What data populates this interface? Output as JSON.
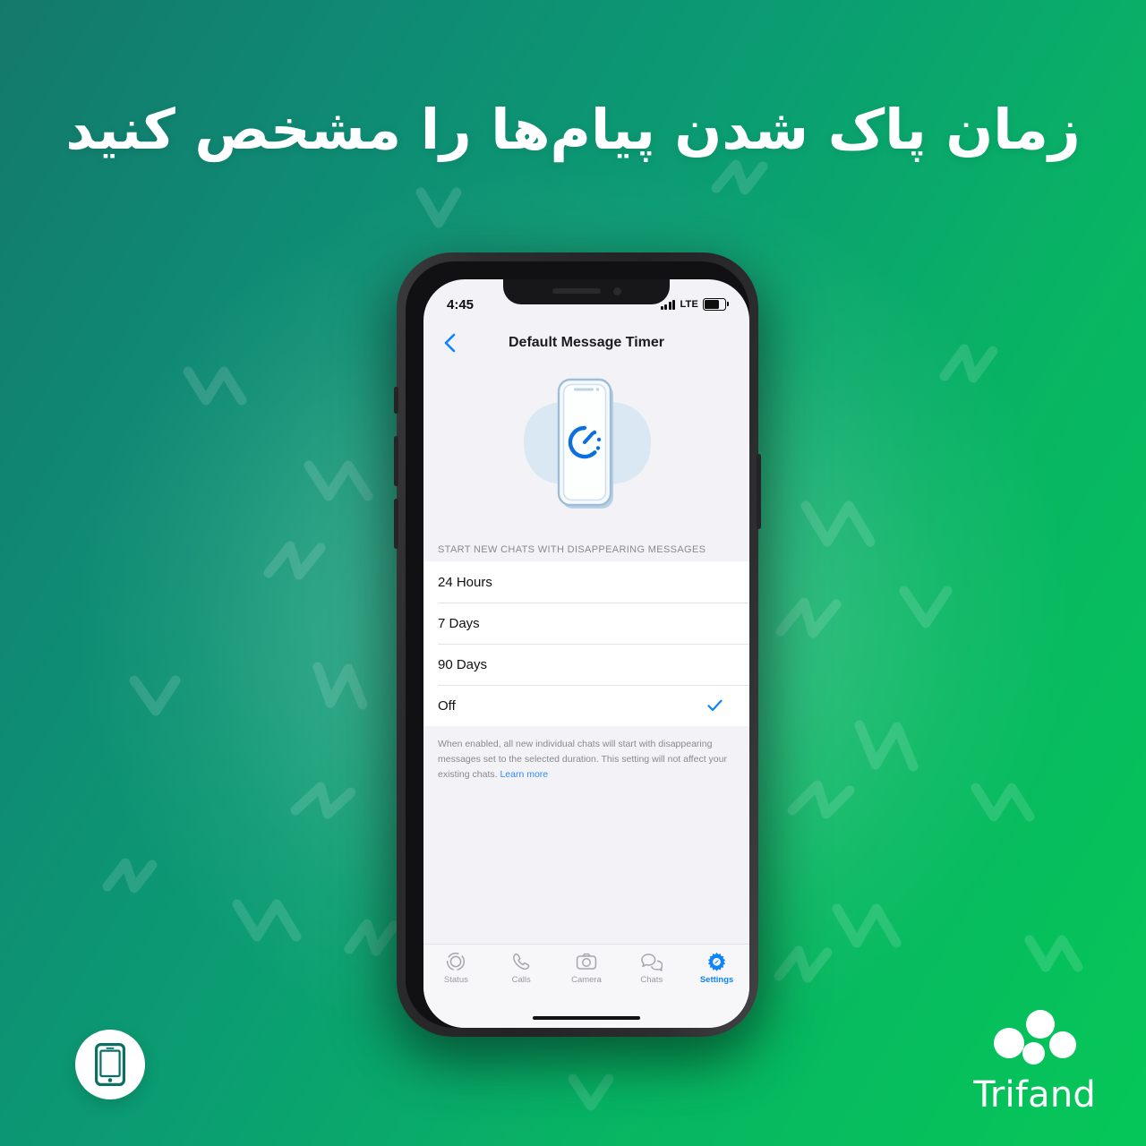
{
  "headline": "زمان پاک شدن پیام‌ها را مشخص کنید",
  "colors": {
    "gradient_start": "#14796b",
    "gradient_end": "#05c757",
    "accent_blue": "#0b84fe",
    "screen_bg": "#f2f2f7",
    "brand_white": "#ffffff"
  },
  "phone": {
    "status_bar": {
      "time": "4:45",
      "network": "LTE",
      "signal_icon": "signal-bars-icon",
      "battery_icon": "battery-icon"
    },
    "nav": {
      "back_icon": "chevron-left-icon",
      "title": "Default Message Timer"
    },
    "hero": {
      "illustration_icon": "phone-timer-illustration"
    },
    "section": {
      "header": "START NEW CHATS WITH DISAPPEARING MESSAGES",
      "options": [
        {
          "label": "24 Hours",
          "selected": false
        },
        {
          "label": "7 Days",
          "selected": false
        },
        {
          "label": "90 Days",
          "selected": false
        },
        {
          "label": "Off",
          "selected": true
        }
      ],
      "selected_icon": "checkmark-icon"
    },
    "footnote": {
      "text": "When enabled, all new individual chats will start with disappearing messages set to the selected duration. This setting will not affect your existing chats. ",
      "link": "Learn more"
    },
    "tabbar": [
      {
        "label": "Status",
        "icon": "status-rings-icon",
        "active": false
      },
      {
        "label": "Calls",
        "icon": "phone-handset-icon",
        "active": false
      },
      {
        "label": "Camera",
        "icon": "camera-icon",
        "active": false
      },
      {
        "label": "Chats",
        "icon": "chat-bubbles-icon",
        "active": false
      },
      {
        "label": "Settings",
        "icon": "gear-icon",
        "active": true
      }
    ]
  },
  "brand": {
    "name": "Trifand",
    "mark_icon": "trifand-dots-logo"
  },
  "badge": {
    "icon": "smartphone-icon"
  }
}
